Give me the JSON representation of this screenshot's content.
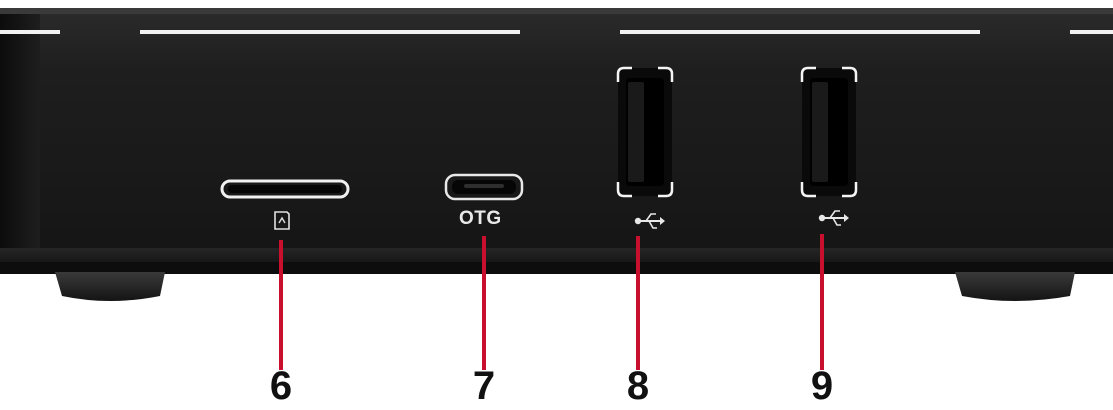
{
  "ports": [
    {
      "id": "sd-card-slot",
      "label": "",
      "icon": "sd-card-icon",
      "callout": "6"
    },
    {
      "id": "micro-usb-otg",
      "label": "OTG",
      "icon": "",
      "callout": "7"
    },
    {
      "id": "usb-port-1",
      "label": "",
      "icon": "usb-icon",
      "callout": "8"
    },
    {
      "id": "usb-port-2",
      "label": "",
      "icon": "usb-icon",
      "callout": "9"
    }
  ],
  "colors": {
    "device_body": "#1c1c1c",
    "highlight": "#f2f2f2",
    "callout_line": "#c8102e",
    "callout_text": "#111111"
  }
}
